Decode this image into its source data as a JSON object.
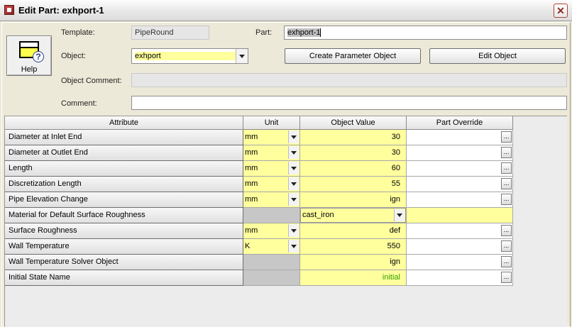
{
  "window": {
    "title": "Edit Part: exhport-1"
  },
  "help": {
    "label": "Help"
  },
  "form": {
    "template_label": "Template:",
    "template_value": "PipeRound",
    "part_label": "Part:",
    "part_value": "exhport-1",
    "object_label": "Object:",
    "object_value": "exhport",
    "create_button": "Create Parameter Object",
    "edit_button": "Edit Object",
    "object_comment_label": "Object Comment:",
    "object_comment_value": "",
    "comment_label": "Comment:",
    "comment_value": ""
  },
  "table": {
    "headers": [
      "Attribute",
      "Unit",
      "Object Value",
      "Part Override"
    ],
    "rows": [
      {
        "attribute": "Diameter at Inlet End",
        "unit": "mm",
        "value": "30",
        "override": ""
      },
      {
        "attribute": "Diameter at Outlet End",
        "unit": "mm",
        "value": "30",
        "override": ""
      },
      {
        "attribute": "Length",
        "unit": "mm",
        "value": "60",
        "override": ""
      },
      {
        "attribute": "Discretization Length",
        "unit": "mm",
        "value": "55",
        "override": ""
      },
      {
        "attribute": "Pipe Elevation Change",
        "unit": "mm",
        "value": "ign",
        "override": ""
      },
      {
        "attribute": "Material for Default Surface Roughness",
        "unit": "",
        "value": "cast_iron",
        "override": ""
      },
      {
        "attribute": "Surface Roughness",
        "unit": "mm",
        "value": "def",
        "override": ""
      },
      {
        "attribute": "Wall Temperature",
        "unit": "K",
        "value": "550",
        "override": ""
      },
      {
        "attribute": "Wall Temperature Solver Object",
        "unit": "",
        "value": "ign",
        "override": ""
      },
      {
        "attribute": "Initial State Name",
        "unit": "",
        "value": "initial",
        "override": ""
      }
    ]
  },
  "colors": {
    "editable_cell": "#ffff9e",
    "disabled_cell": "#c7c7c7",
    "default_value_text": "#33a000"
  }
}
